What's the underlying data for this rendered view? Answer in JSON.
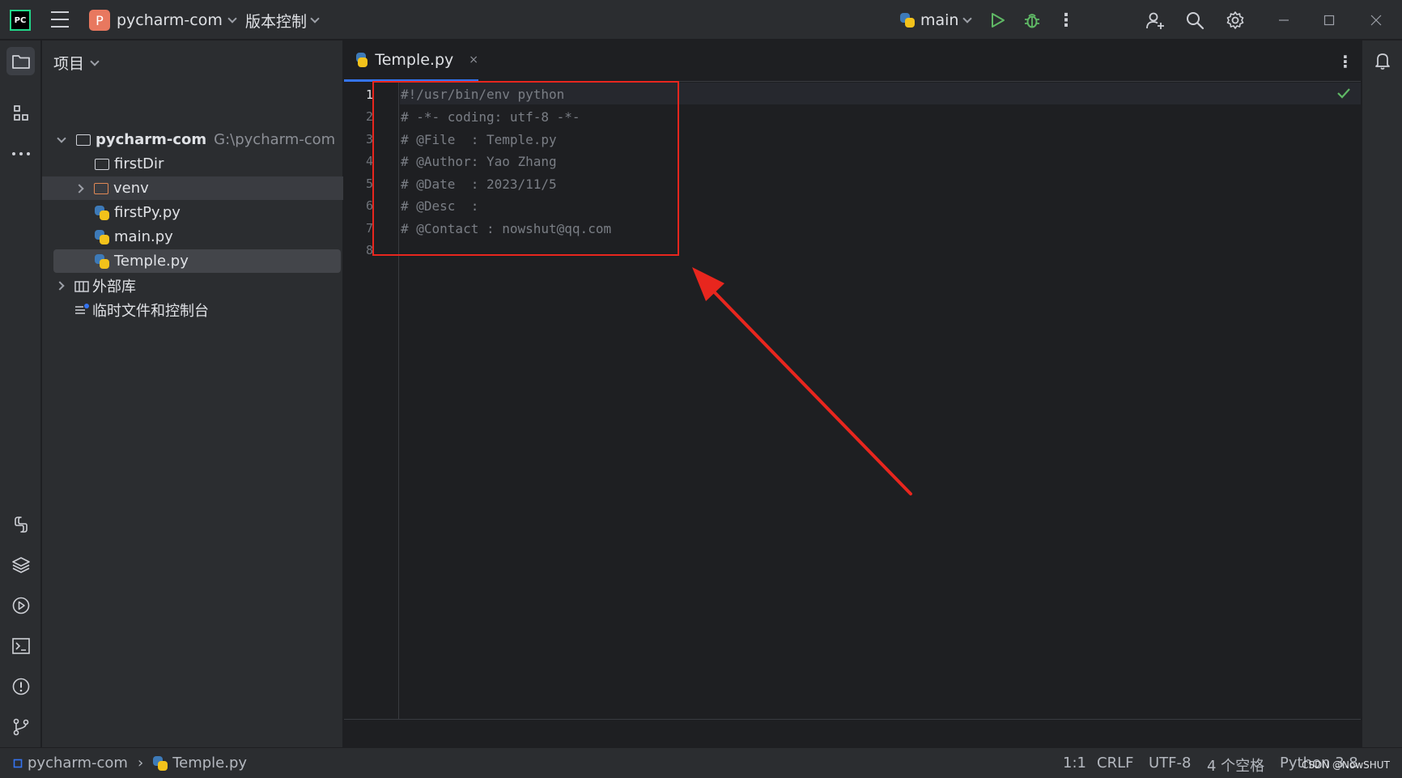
{
  "titlebar": {
    "logo_text": "PC",
    "project_badge": "P",
    "project_name": "pycharm-com",
    "vcs_label": "版本控制",
    "run_config": "main",
    "more": "⋮"
  },
  "project_panel": {
    "title": "项目",
    "root_name": "pycharm-com",
    "root_path": "G:\\pycharm-com",
    "items": [
      {
        "label": "firstDir"
      },
      {
        "label": "venv"
      },
      {
        "label": "firstPy.py"
      },
      {
        "label": "main.py"
      },
      {
        "label": "Temple.py"
      }
    ],
    "external_libs": "外部库",
    "scratches": "临时文件和控制台"
  },
  "editor": {
    "tab_label": "Temple.py",
    "tab_close": "×",
    "menu": "⋮",
    "line_numbers": [
      "1",
      "2",
      "3",
      "4",
      "5",
      "6",
      "7",
      "8"
    ],
    "lines": [
      "#!/usr/bin/env python",
      "# -*- coding: utf-8 -*-",
      "# @File  : Temple.py",
      "# @Author: Yao Zhang",
      "# @Date  : 2023/11/5",
      "# @Desc  :",
      "# @Contact : nowshut@qq.com",
      ""
    ]
  },
  "status_bar": {
    "breadcrumb_project": "pycharm-com",
    "breadcrumb_sep": "›",
    "breadcrumb_file": "Temple.py",
    "position": "1:1",
    "line_sep": "CRLF",
    "encoding": "UTF-8",
    "indent": "4 个空格",
    "interpreter": "Python 3.8",
    "watermark": "CSDN @NowSHUT"
  },
  "colors": {
    "accent": "#3574f0",
    "annotation": "#e8261e",
    "run_green": "#5fb865",
    "folder_orange": "#e08855"
  }
}
